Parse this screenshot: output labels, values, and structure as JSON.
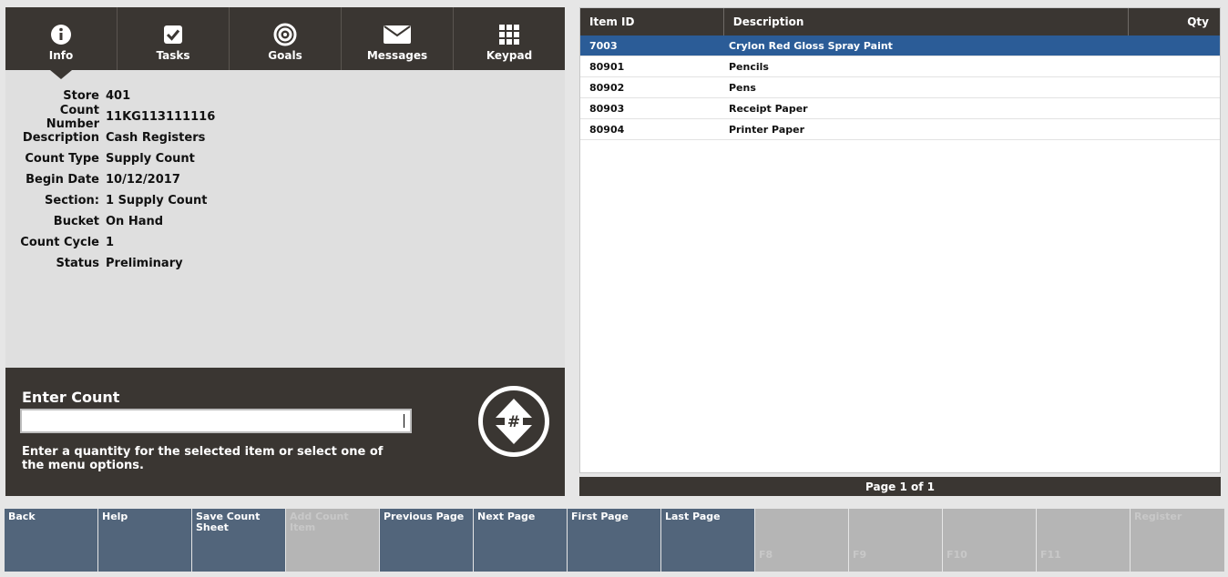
{
  "tabs": [
    {
      "label": "Info",
      "icon": "info-icon"
    },
    {
      "label": "Tasks",
      "icon": "checkbox-icon"
    },
    {
      "label": "Goals",
      "icon": "target-icon"
    },
    {
      "label": "Messages",
      "icon": "envelope-icon"
    },
    {
      "label": "Keypad",
      "icon": "keypad-icon"
    }
  ],
  "info": {
    "fields": [
      {
        "label": "Store",
        "value": "401"
      },
      {
        "label": "Count Number",
        "value": "11KG113111116"
      },
      {
        "label": "Description",
        "value": "Cash Registers"
      },
      {
        "label": "Count Type",
        "value": "Supply Count"
      },
      {
        "label": "Begin Date",
        "value": "10/12/2017"
      },
      {
        "label": "Section:",
        "value": "1 Supply Count"
      },
      {
        "label": "Bucket",
        "value": "On Hand"
      },
      {
        "label": "Count Cycle",
        "value": "1"
      },
      {
        "label": "Status",
        "value": "Preliminary"
      }
    ]
  },
  "entry": {
    "title": "Enter Count",
    "value": "",
    "help": "Enter a quantity for the selected item or select one of the menu options.",
    "button_symbol": "#"
  },
  "grid": {
    "headers": {
      "id": "Item ID",
      "desc": "Description",
      "qty": "Qty"
    },
    "rows": [
      {
        "id": "7003",
        "desc": "Crylon Red Gloss Spray Paint",
        "qty": ""
      },
      {
        "id": "80901",
        "desc": "Pencils",
        "qty": ""
      },
      {
        "id": "80902",
        "desc": "Pens",
        "qty": ""
      },
      {
        "id": "80903",
        "desc": "Receipt Paper",
        "qty": ""
      },
      {
        "id": "80904",
        "desc": "Printer Paper",
        "qty": ""
      }
    ],
    "selected_index": 0
  },
  "pager": {
    "text": "Page 1 of 1"
  },
  "fkeys": [
    {
      "label": "Back",
      "enabled": true,
      "fnum": ""
    },
    {
      "label": "Help",
      "enabled": true,
      "fnum": ""
    },
    {
      "label": "Save Count Sheet",
      "enabled": true,
      "fnum": ""
    },
    {
      "label": "Add Count Item",
      "enabled": false,
      "fnum": ""
    },
    {
      "label": "Previous Page",
      "enabled": true,
      "fnum": ""
    },
    {
      "label": "Next Page",
      "enabled": true,
      "fnum": ""
    },
    {
      "label": "First Page",
      "enabled": true,
      "fnum": ""
    },
    {
      "label": "Last Page",
      "enabled": true,
      "fnum": ""
    },
    {
      "label": "",
      "enabled": false,
      "fnum": "F8"
    },
    {
      "label": "",
      "enabled": false,
      "fnum": "F9"
    },
    {
      "label": "",
      "enabled": false,
      "fnum": "F10"
    },
    {
      "label": "",
      "enabled": false,
      "fnum": "F11"
    },
    {
      "label": "Register",
      "enabled": false,
      "fnum": ""
    }
  ],
  "colors": {
    "dark_bar": "#3a3632",
    "selected_row": "#2b5c97",
    "fkey_enabled": "#52657b",
    "fkey_disabled": "#b5b5b5"
  }
}
